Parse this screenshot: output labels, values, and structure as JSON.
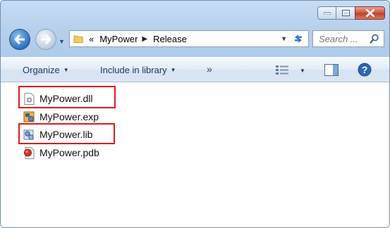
{
  "window": {
    "caption_buttons": [
      "minimize",
      "maximize",
      "close"
    ]
  },
  "address_bar": {
    "overflow_chevron": "«",
    "crumbs": [
      "MyPower",
      "Release"
    ]
  },
  "search": {
    "placeholder": "Search ..."
  },
  "toolbar": {
    "organize_label": "Organize",
    "include_label": "Include in library",
    "more_label": "»"
  },
  "files": [
    {
      "name": "MyPower.dll",
      "icon": "dll-file-icon",
      "highlighted": true
    },
    {
      "name": "MyPower.exp",
      "icon": "exp-file-icon",
      "highlighted": false
    },
    {
      "name": "MyPower.lib",
      "icon": "lib-file-icon",
      "highlighted": true
    },
    {
      "name": "MyPower.pdb",
      "icon": "pdb-file-icon",
      "highlighted": false
    }
  ],
  "colors": {
    "highlight_box": "#e0191b",
    "window_frame": "#b7d0ec",
    "toolbar_text": "#1e395b"
  }
}
